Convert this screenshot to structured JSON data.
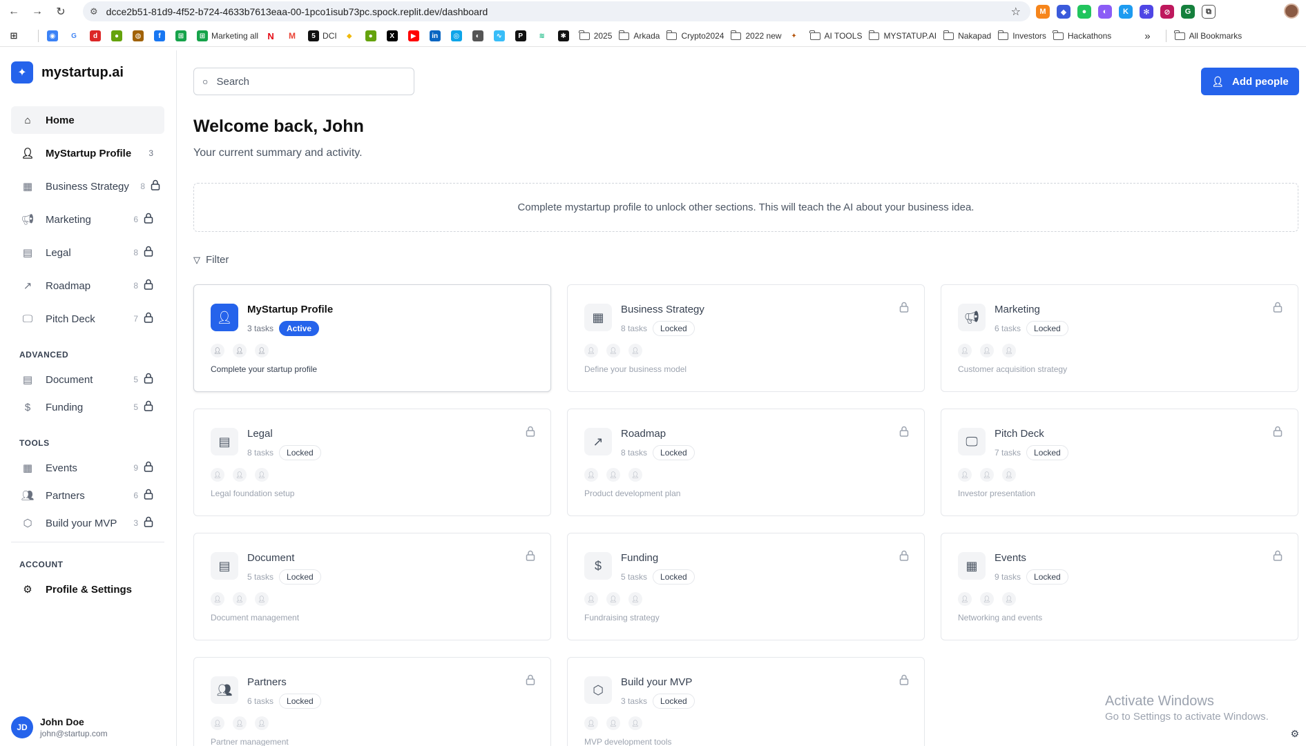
{
  "browser": {
    "url": "dcce2b51-81d9-4f52-b724-4633b7613eaa-00-1pco1isub73pc.spock.replit.dev/dashboard",
    "bookmarks": [
      "Marketing all",
      "DCI",
      "2025",
      "Arkada",
      "Crypto2024",
      "2022 new",
      "AI TOOLS",
      "MYSTATUP.AI",
      "Nakapad",
      "Investors",
      "Hackathons",
      "All Bookmarks"
    ],
    "more_label": "»"
  },
  "sidebar": {
    "brand": "mystartup.ai",
    "items": [
      {
        "label": "Home",
        "icon": "home-icon"
      },
      {
        "label": "MyStartup Profile",
        "count": "3"
      },
      {
        "label": "Business Strategy",
        "count": "8"
      },
      {
        "label": "Marketing",
        "count": "6"
      },
      {
        "label": "Legal",
        "count": "8"
      },
      {
        "label": "Roadmap",
        "count": "8"
      },
      {
        "label": "Pitch Deck",
        "count": "7"
      }
    ],
    "advanced_label": "ADVANCED",
    "advanced": [
      {
        "label": "Document",
        "count": "5"
      },
      {
        "label": "Funding",
        "count": "5"
      }
    ],
    "tools_label": "TOOLS",
    "tools": [
      {
        "label": "Events",
        "count": "9"
      },
      {
        "label": "Partners",
        "count": "6"
      },
      {
        "label": "Build your MVP",
        "count": "3"
      }
    ],
    "account_label": "ACCOUNT",
    "account": [
      {
        "label": "Profile & Settings"
      }
    ],
    "user": {
      "initials": "JD",
      "name": "John Doe",
      "email": "john@startup.com"
    }
  },
  "main": {
    "search_placeholder": "Search",
    "add_button": "Add people",
    "welcome": "Welcome back, John",
    "subtitle": "Your current summary and activity.",
    "notice": "Complete mystartup profile to unlock other sections. This will teach the AI about your business idea.",
    "filter": "Filter",
    "cards": [
      {
        "title": "MyStartup Profile",
        "tasks": "3 tasks",
        "status": "Active",
        "desc": "Complete your startup profile"
      },
      {
        "title": "Business Strategy",
        "tasks": "8 tasks",
        "status": "Locked",
        "desc": "Define your business model"
      },
      {
        "title": "Marketing",
        "tasks": "6 tasks",
        "status": "Locked",
        "desc": "Customer acquisition strategy"
      },
      {
        "title": "Legal",
        "tasks": "8 tasks",
        "status": "Locked",
        "desc": "Legal foundation setup"
      },
      {
        "title": "Roadmap",
        "tasks": "8 tasks",
        "status": "Locked",
        "desc": "Product development plan"
      },
      {
        "title": "Pitch Deck",
        "tasks": "7 tasks",
        "status": "Locked",
        "desc": "Investor presentation"
      },
      {
        "title": "Document",
        "tasks": "5 tasks",
        "status": "Locked",
        "desc": "Document management"
      },
      {
        "title": "Funding",
        "tasks": "5 tasks",
        "status": "Locked",
        "desc": "Fundraising strategy"
      },
      {
        "title": "Events",
        "tasks": "9 tasks",
        "status": "Locked",
        "desc": "Networking and events"
      },
      {
        "title": "Partners",
        "tasks": "6 tasks",
        "status": "Locked",
        "desc": "Partner management"
      },
      {
        "title": "Build your MVP",
        "tasks": "3 tasks",
        "status": "Locked",
        "desc": "MVP development tools"
      }
    ]
  },
  "os": {
    "watermark_title": "Activate Windows",
    "watermark_sub": "Go to Settings to activate Windows."
  },
  "colors": {
    "accent": "#2563eb",
    "muted": "#9ca3af",
    "border": "#e5e7eb"
  }
}
